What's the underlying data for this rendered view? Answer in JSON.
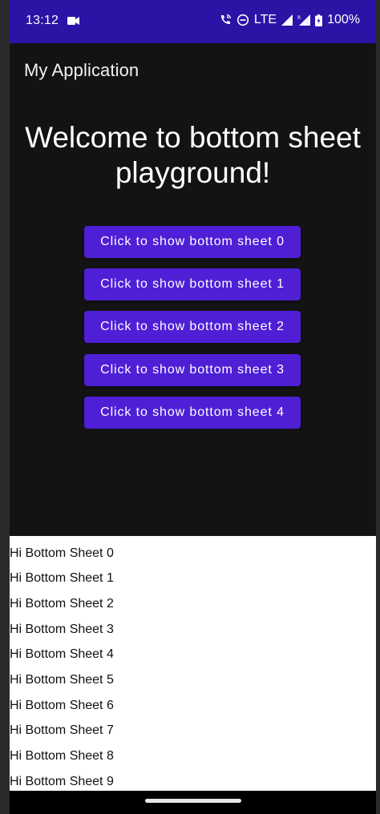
{
  "status_bar": {
    "time": "13:12",
    "network": "LTE",
    "battery": "100%",
    "icons": [
      "video-camera-icon",
      "wifi-calling-icon",
      "do-not-disturb-icon",
      "signal-icon",
      "roaming-signal-icon",
      "battery-icon"
    ]
  },
  "app_bar": {
    "title": "My Application"
  },
  "main": {
    "welcome_text": "Welcome to bottom sheet playground!",
    "buttons": [
      {
        "label": "Click to show bottom sheet 0"
      },
      {
        "label": "Click to show bottom sheet 1"
      },
      {
        "label": "Click to show bottom sheet 2"
      },
      {
        "label": "Click to show bottom sheet 3"
      },
      {
        "label": "Click to show bottom sheet 4"
      }
    ]
  },
  "bottom_sheet": {
    "items": [
      "Hi Bottom Sheet 0",
      "Hi Bottom Sheet 1",
      "Hi Bottom Sheet 2",
      "Hi Bottom Sheet 3",
      "Hi Bottom Sheet 4",
      "Hi Bottom Sheet 5",
      "Hi Bottom Sheet 6",
      "Hi Bottom Sheet 7",
      "Hi Bottom Sheet 8",
      "Hi Bottom Sheet 9"
    ]
  },
  "colors": {
    "status_bar_bg": "#2a14a6",
    "background": "#131313",
    "button_bg": "#4f1fd6",
    "sheet_bg": "#ffffff"
  }
}
